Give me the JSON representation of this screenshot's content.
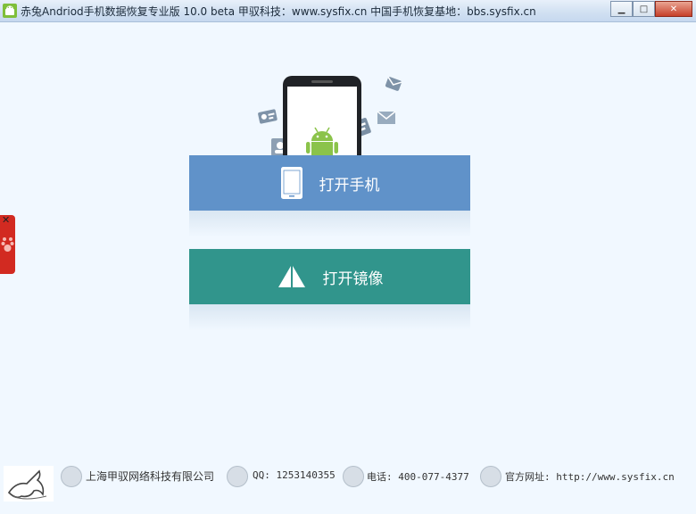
{
  "window": {
    "title": "赤兔Andriod手机数据恢复专业版 10.0 beta 甲驭科技：www.sysfix.cn 中国手机恢复基地：bbs.sysfix.cn",
    "minimize_glyph": "▁",
    "maximize_glyph": "□",
    "close_glyph": "✕"
  },
  "main": {
    "open_phone_label": "打开手机",
    "open_image_label": "打开镜像"
  },
  "side_tab": {
    "close_glyph": "✕"
  },
  "footer": {
    "company": "上海甲驭网络科技有限公司",
    "qq": "QQ: 1253140355",
    "phone": "电话: 400-077-4377",
    "website": "官方网址: http://www.sysfix.cn"
  },
  "colors": {
    "open_phone_bg": "#6092c9",
    "open_image_bg": "#31958c",
    "android_green": "#8bc34a"
  }
}
